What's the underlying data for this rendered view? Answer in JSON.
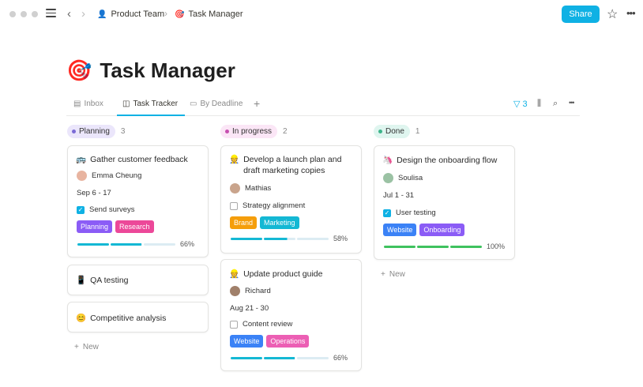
{
  "breadcrumb": {
    "team": "Product Team",
    "page": "Task Manager"
  },
  "header": {
    "share_label": "Share"
  },
  "page": {
    "title": "Task Manager",
    "title_emoji": "🎯"
  },
  "tabs": [
    {
      "label": "Inbox",
      "icon": "table-icon"
    },
    {
      "label": "Task Tracker",
      "icon": "board-icon"
    },
    {
      "label": "By Deadline",
      "icon": "calendar-icon"
    }
  ],
  "toolbar": {
    "filter_count": "3"
  },
  "columns": {
    "planning": {
      "label": "Planning",
      "count": "3",
      "color": "#ebe6fb",
      "dot": "#7b6bd6"
    },
    "progress": {
      "label": "In progress",
      "count": "2",
      "color": "#fbe6f6",
      "dot": "#c74fb0"
    },
    "done": {
      "label": "Done",
      "count": "1",
      "color": "#dff5ef",
      "dot": "#3db48a"
    }
  },
  "cards": {
    "c1": {
      "emoji": "🚌",
      "title": "Gather customer feedback",
      "person": "Emma Cheung",
      "dates": "Sep 6 - 17",
      "task": "Send surveys",
      "tags": [
        "Planning",
        "Research"
      ],
      "progress": 0.66,
      "pct": "66%"
    },
    "c2": {
      "emoji": "📱",
      "title": "QA testing"
    },
    "c3": {
      "emoji": "😊",
      "title": "Competitive analysis"
    },
    "c4": {
      "emoji": "👷",
      "title": "Develop a launch plan and draft marketing copies",
      "person": "Mathias",
      "task": "Strategy alignment",
      "tags": [
        "Brand",
        "Marketing"
      ],
      "progress": 0.58,
      "pct": "58%"
    },
    "c5": {
      "emoji": "👷",
      "title": "Update product guide",
      "person": "Richard",
      "dates": "Aug 21 - 30",
      "task": "Content review",
      "tags": [
        "Website",
        "Operations"
      ],
      "progress": 0.66,
      "pct": "66%"
    },
    "c6": {
      "emoji": "🦄",
      "title": "Design the onboarding flow",
      "person": "Soulisa",
      "dates": "Jul 1 - 31",
      "task": "User testing",
      "tags": [
        "Website",
        "Onboarding"
      ],
      "progress": 1.0,
      "pct": "100%"
    }
  },
  "tag_colors": {
    "Planning": "#8b5cf6",
    "Research": "#ec4899",
    "Brand": "#f59e0b",
    "Marketing": "#14b8d4",
    "Website": "#3b82f6",
    "Operations": "#ec5fb4",
    "Onboarding": "#8b5cf6"
  },
  "new_label": "New"
}
